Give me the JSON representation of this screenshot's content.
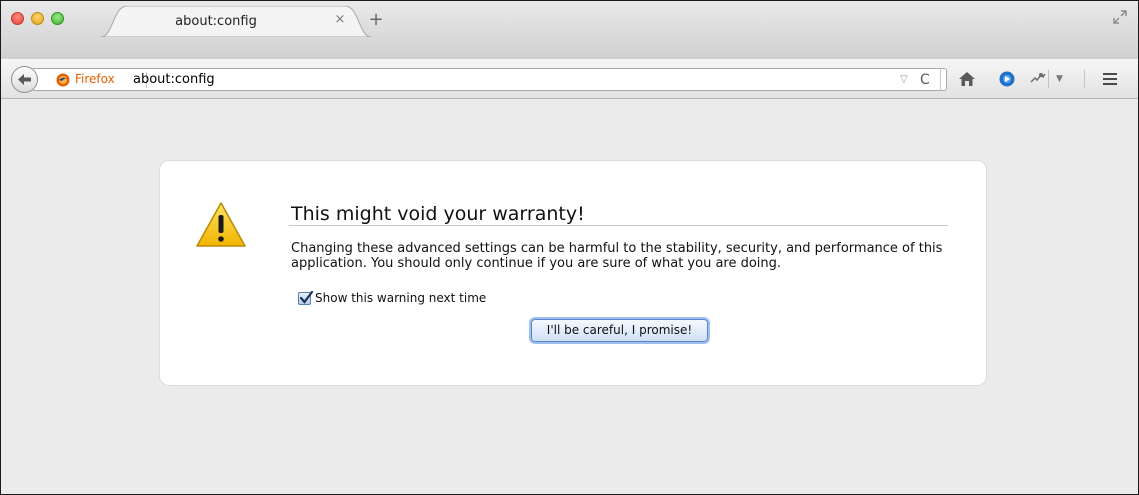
{
  "tab": {
    "title": "about:config",
    "close_glyph": "×",
    "new_tab_glyph": "+"
  },
  "toolbar": {
    "identity_label": "Firefox",
    "url": "about:config",
    "dropdown_glyph": "▽",
    "reload_glyph": "C",
    "addon_dropdown_glyph": "▼"
  },
  "warning": {
    "title": "This might void your warranty!",
    "description": "Changing these advanced settings can be harmful to the stability, security, and performance of this application. You should only continue if you are sure of what you are doing.",
    "checkbox_label": "Show this warning next time",
    "checkbox_checked": true,
    "button_label": "I'll be careful, I promise!"
  },
  "icons": [
    "close-window-icon",
    "minimize-window-icon",
    "maximize-window-icon",
    "fullscreen-icon",
    "back-arrow-icon",
    "firefox-logo-icon",
    "home-icon",
    "pocket-icon",
    "addon-icon",
    "hamburger-menu-icon",
    "warning-triangle-icon"
  ],
  "colors": {
    "identity": "#e66000",
    "warning_yellow": "#f5c400",
    "button_focus": "#9fc0ee"
  }
}
